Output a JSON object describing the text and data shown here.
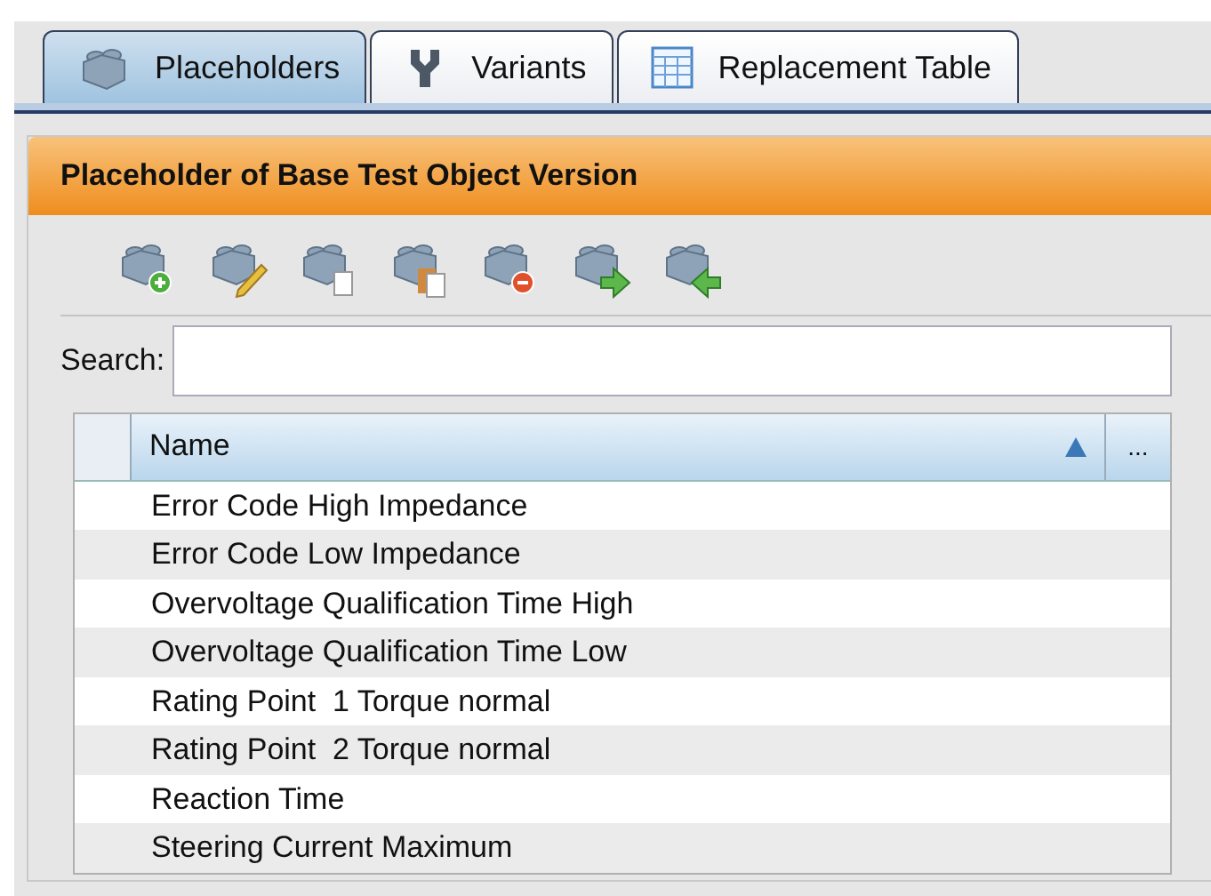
{
  "tabs": [
    {
      "label": "Placeholders",
      "kind": "brick",
      "selected": true
    },
    {
      "label": "Variants",
      "kind": "fork",
      "selected": false
    },
    {
      "label": "Replacement Table",
      "kind": "table",
      "selected": false
    }
  ],
  "panel": {
    "title": "Placeholder of Base Test Object Version",
    "toolbar": [
      {
        "kind": "add"
      },
      {
        "kind": "edit"
      },
      {
        "kind": "copy"
      },
      {
        "kind": "paste"
      },
      {
        "kind": "remove"
      },
      {
        "kind": "export"
      },
      {
        "kind": "import"
      }
    ],
    "search": {
      "label": "Search:"
    },
    "table": {
      "columns": [
        {
          "label": "Name",
          "sorted_ascending": true
        },
        {
          "label": "..."
        }
      ],
      "rows": [
        "Error Code High Impedance",
        "Error Code Low Impedance",
        "Overvoltage Qualification Time High",
        "Overvoltage Qualification Time Low",
        "Rating Point  1 Torque normal",
        "Rating Point  2 Torque normal",
        "Reaction Time",
        "Steering Current Maximum"
      ]
    }
  }
}
